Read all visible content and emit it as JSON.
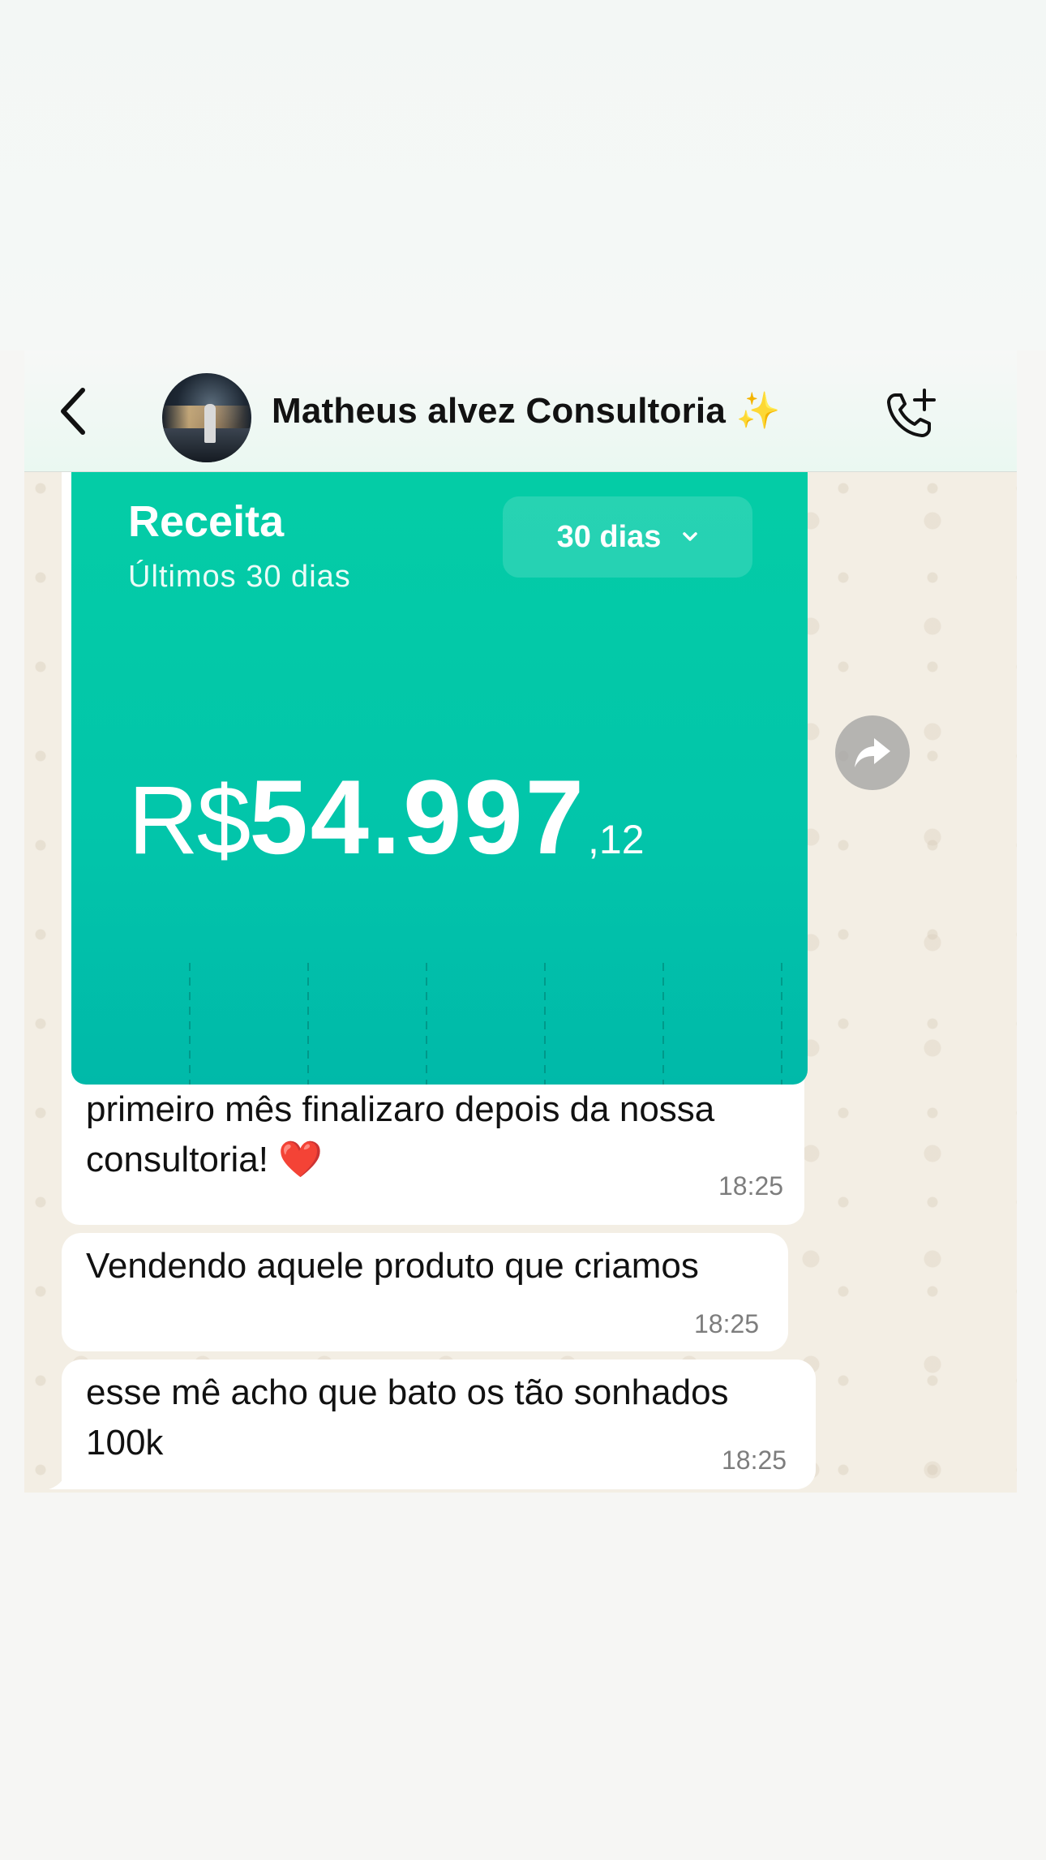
{
  "header": {
    "contact_name": "Matheus alvez Consultoria",
    "title_emoji": "✨",
    "back_icon": "chevron-left-icon",
    "call_icon": "phone-plus-icon"
  },
  "revenue_card": {
    "title": "Receita",
    "subtitle": "Últimos 30 dias",
    "period_selected": "30 dias",
    "currency": "R$",
    "amount_integer": "54.997",
    "amount_cents": ",12",
    "accent": "#03c9a8"
  },
  "messages": [
    {
      "text": "primeiro mês finalizaro depois da nossa consultoria! ❤️",
      "time": "18:25"
    },
    {
      "text": "Vendendo aquele produto que criamos",
      "time": "18:25"
    },
    {
      "text": "esse mê acho que bato os tão sonhados 100k",
      "time": "18:25"
    }
  ]
}
